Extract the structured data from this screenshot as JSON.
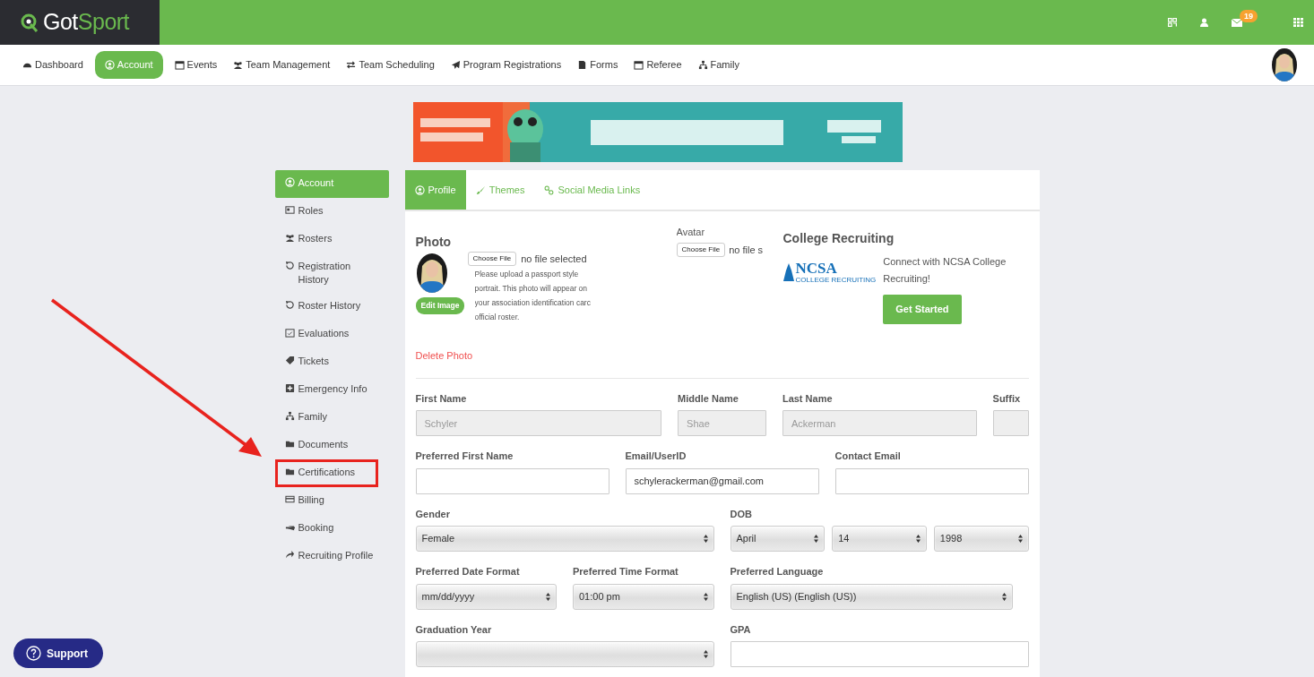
{
  "brand": {
    "name_a": "Got",
    "name_b": "Sport"
  },
  "top_icons": {
    "mail_badge": "19"
  },
  "nav": [
    {
      "label": "Dashboard",
      "selected": false
    },
    {
      "label": "Account",
      "selected": true
    },
    {
      "label": "Events",
      "selected": false
    },
    {
      "label": "Team Management",
      "selected": false
    },
    {
      "label": "Team Scheduling",
      "selected": false
    },
    {
      "label": "Program Registrations",
      "selected": false
    },
    {
      "label": "Forms",
      "selected": false
    },
    {
      "label": "Referee",
      "selected": false
    },
    {
      "label": "Family",
      "selected": false
    }
  ],
  "sidebar": [
    {
      "label": "Account",
      "selected": true,
      "highlighted": false
    },
    {
      "label": "Roles",
      "selected": false,
      "highlighted": false
    },
    {
      "label": "Rosters",
      "selected": false,
      "highlighted": false
    },
    {
      "label": "Registration History",
      "selected": false,
      "highlighted": false
    },
    {
      "label": "Roster History",
      "selected": false,
      "highlighted": false
    },
    {
      "label": "Evaluations",
      "selected": false,
      "highlighted": false
    },
    {
      "label": "Tickets",
      "selected": false,
      "highlighted": false
    },
    {
      "label": "Emergency Info",
      "selected": false,
      "highlighted": false
    },
    {
      "label": "Family",
      "selected": false,
      "highlighted": false
    },
    {
      "label": "Documents",
      "selected": false,
      "highlighted": false
    },
    {
      "label": "Certifications",
      "selected": false,
      "highlighted": true
    },
    {
      "label": "Billing",
      "selected": false,
      "highlighted": false
    },
    {
      "label": "Booking",
      "selected": false,
      "highlighted": false
    },
    {
      "label": "Recruiting Profile",
      "selected": false,
      "highlighted": false
    }
  ],
  "tabs": [
    {
      "label": "Profile",
      "selected": true
    },
    {
      "label": "Themes",
      "selected": false
    },
    {
      "label": "Social Media Links",
      "selected": false
    }
  ],
  "photo": {
    "title": "Photo",
    "edit_button": "Edit Image",
    "choose_button": "Choose File",
    "file_status": "no file selected",
    "help": "Please upload a passport style portrait. This photo will appear on your association identification carc official roster.",
    "delete_link": "Delete Photo"
  },
  "avatar": {
    "title": "Avatar",
    "choose_button": "Choose File",
    "file_status": "no file s"
  },
  "college": {
    "title": "College Recruiting",
    "logo_text": "NCSA",
    "logo_subtext": "COLLEGE RECRUITING",
    "text": "Connect with NCSA College Recruiting!",
    "button": "Get Started"
  },
  "form_rows": [
    {
      "fields": [
        {
          "label": "First Name",
          "kind": "text",
          "value": "Schyler",
          "disabled": true
        },
        {
          "label": "Middle Name",
          "kind": "text",
          "value": "Shae",
          "disabled": true
        },
        {
          "label": "Last Name",
          "kind": "text",
          "value": "Ackerman",
          "disabled": true
        },
        {
          "label": "Suffix",
          "kind": "text",
          "disabled": true
        }
      ]
    },
    {
      "fields": [
        {
          "label": "Preferred First Name",
          "kind": "text",
          "disabled": false
        },
        {
          "label": "Email/UserID",
          "kind": "text",
          "value": "schylerackerman@gmail.com",
          "disabled": false
        },
        {
          "label": "Contact Email",
          "kind": "text",
          "disabled": false
        }
      ]
    },
    {
      "fields": [
        {
          "label": "Gender",
          "kind": "select",
          "values": [
            "Female"
          ]
        },
        {
          "label": "DOB",
          "kind": "select",
          "values": [
            "April",
            "14",
            "1998"
          ]
        }
      ]
    },
    {
      "fields": [
        {
          "label": "Preferred Date Format",
          "kind": "select",
          "values": [
            "mm/dd/yyyy"
          ]
        },
        {
          "label": "Preferred Time Format",
          "kind": "select",
          "values": [
            "01:00 pm"
          ]
        },
        {
          "label": "Preferred Language",
          "kind": "select",
          "values": [
            "English (US) (English (US))"
          ]
        }
      ]
    },
    {
      "fields": [
        {
          "label": "Graduation Year",
          "kind": "select"
        },
        {
          "label": "GPA",
          "kind": "text",
          "disabled": false
        }
      ]
    }
  ],
  "support_button": "Support"
}
